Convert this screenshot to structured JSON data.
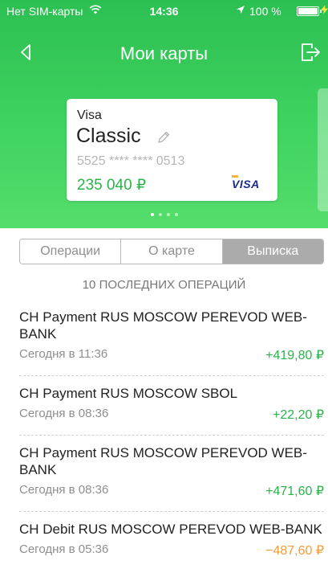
{
  "status_bar": {
    "carrier": "Нет SIM-карты",
    "time": "14:36",
    "battery": "100 %"
  },
  "nav": {
    "title": "Мои карты"
  },
  "card": {
    "brand": "Visa",
    "name": "Classic",
    "number": "5525 **** **** 0513",
    "balance": "235 040 ₽",
    "logo_text": "VISA"
  },
  "pager": {
    "count": 4,
    "active_index": 0
  },
  "tabs": [
    {
      "label": "Операции",
      "active": false
    },
    {
      "label": "О карте",
      "active": false
    },
    {
      "label": "Выписка",
      "active": true
    }
  ],
  "section_title": "10 ПОСЛЕДНИХ ОПЕРАЦИЙ",
  "transactions": [
    {
      "description": "CH Payment RUS MOSCOW PEREVOD WEB-BANK",
      "date": "Сегодня в 11:36",
      "amount": "+419,80 ₽",
      "type": "income"
    },
    {
      "description": "CH Payment RUS MOSCOW SBOL",
      "date": "Сегодня в 08:36",
      "amount": "+22,20 ₽",
      "type": "income"
    },
    {
      "description": "CH Payment RUS MOSCOW PEREVOD WEB-BANK",
      "date": "Сегодня в 08:36",
      "amount": "+471,60 ₽",
      "type": "income"
    },
    {
      "description": "CH Debit RUS MOSCOW PEREVOD WEB-BANK",
      "date": "Сегодня в 05:36",
      "amount": "−487,60 ₽",
      "type": "expense"
    }
  ],
  "colors": {
    "accent_green": "#2bb34a",
    "header_green": "#3fd35f",
    "expense_orange": "#f39c38",
    "active_tab": "#ababab"
  }
}
